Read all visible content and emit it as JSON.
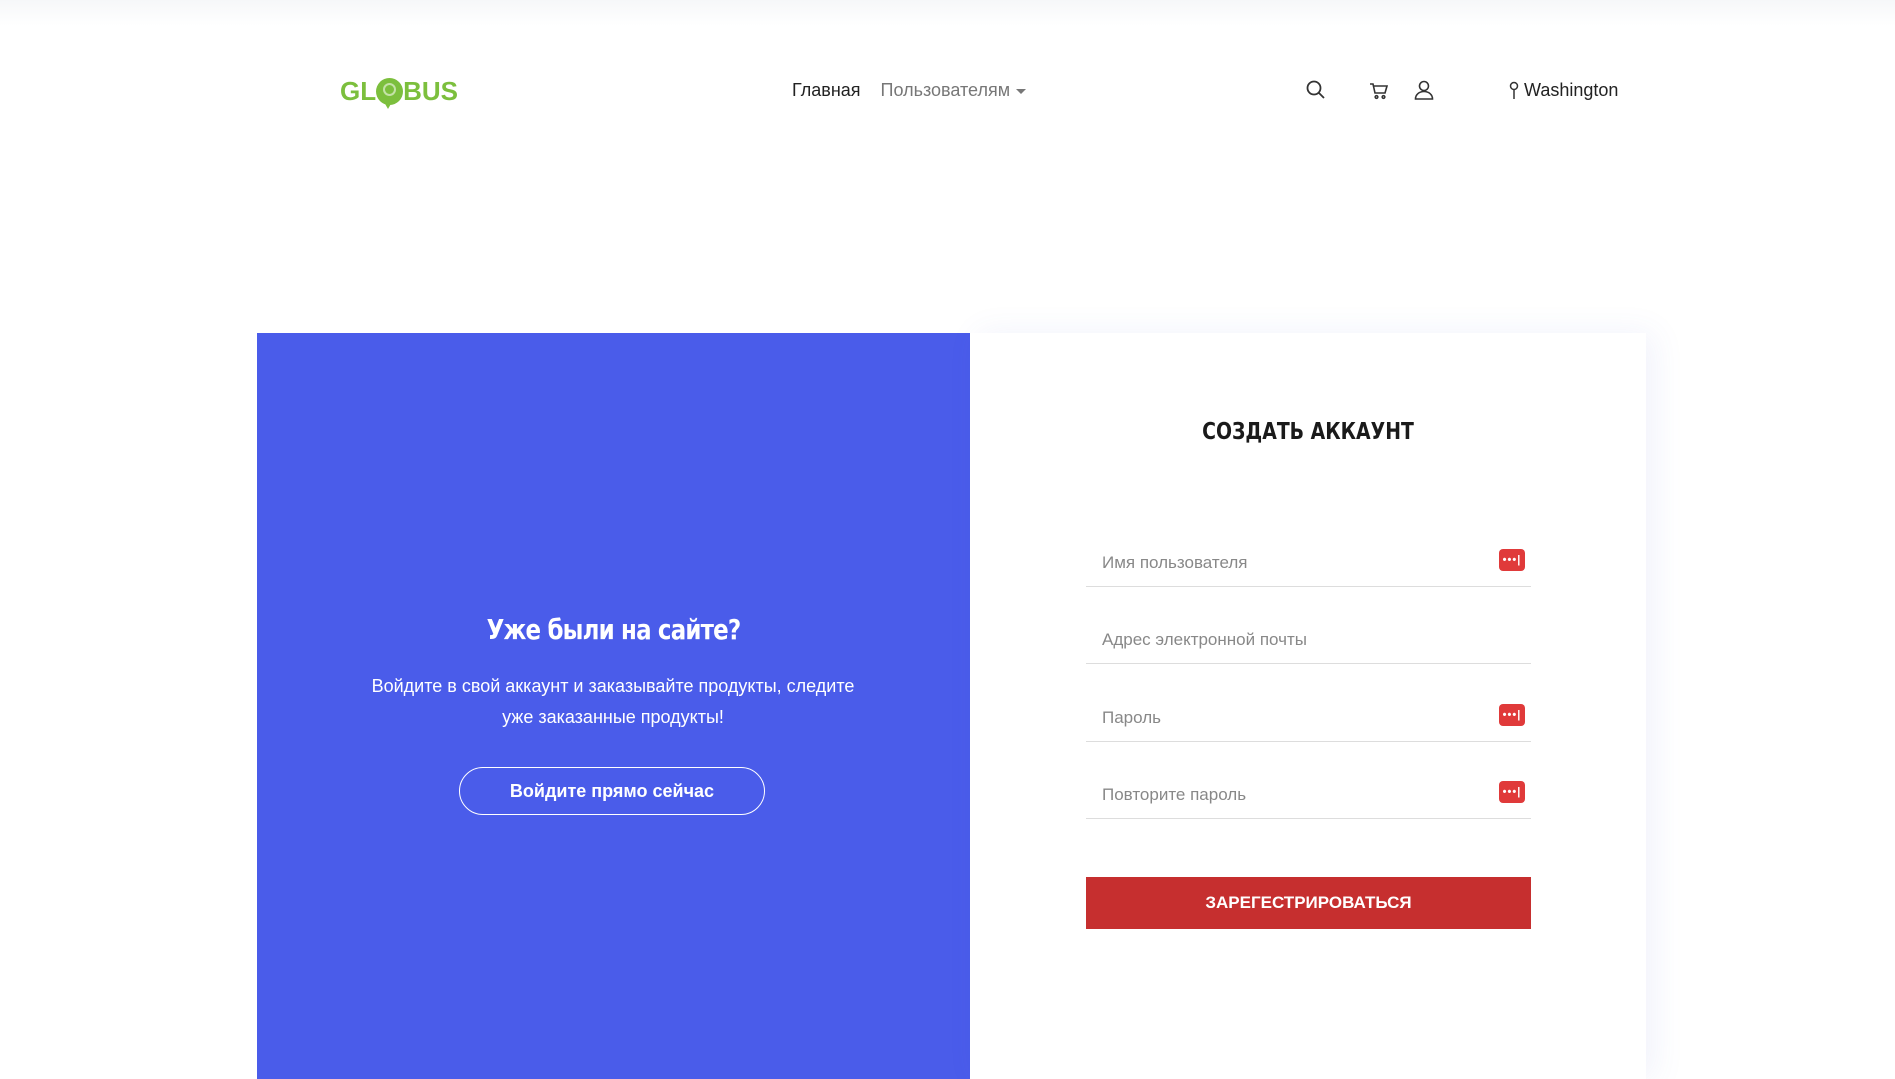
{
  "header": {
    "logo": {
      "prefix": "GL",
      "suffix": "BUS"
    },
    "nav": {
      "home": "Главная",
      "users": "Пользователям"
    },
    "icons": [
      "search-icon",
      "cart-icon",
      "user-icon"
    ],
    "location": "Washington"
  },
  "login_panel": {
    "title": "Уже были на сайте?",
    "text": "Войдите в свой аккаунт и заказывайте продукты, следите уже заказанные продукты!",
    "button": "Войдите прямо сейчас",
    "background": "#4a5cea"
  },
  "register_form": {
    "title": "СОЗДАТЬ АККАУНТ",
    "fields": {
      "username": {
        "placeholder": "Имя пользователя",
        "value": ""
      },
      "email": {
        "placeholder": "Адрес электронной почты",
        "value": ""
      },
      "password": {
        "placeholder": "Пароль",
        "value": ""
      },
      "password_repeat": {
        "placeholder": "Повторите пароль",
        "value": ""
      }
    },
    "submit": "ЗАРЕГЕСТРИРОВАТЬСЯ",
    "submit_color": "#c62f2f"
  }
}
